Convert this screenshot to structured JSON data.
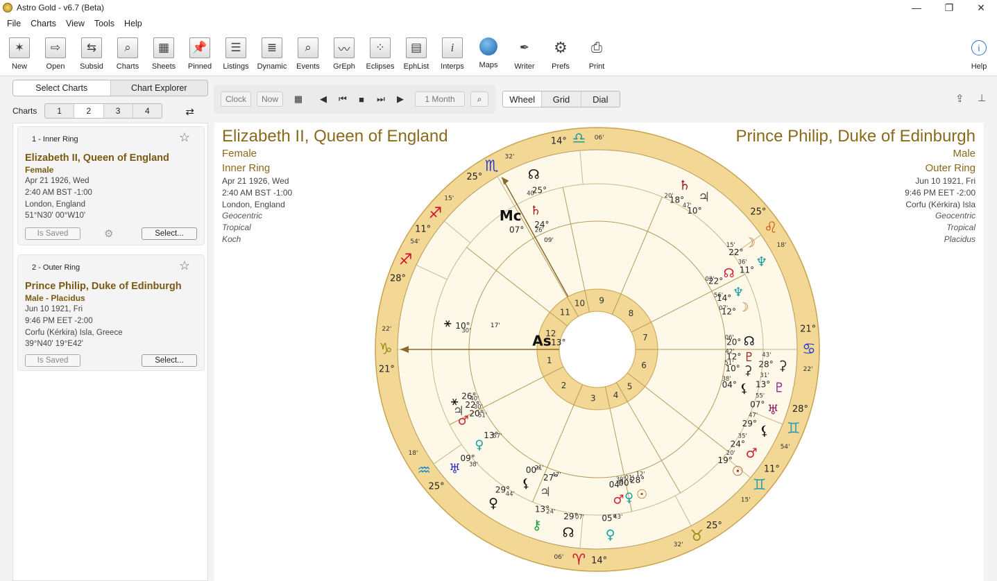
{
  "window": {
    "title": "Astro Gold - v6.7 (Beta)",
    "minimize": "—",
    "maximize": "❐",
    "close": "✕"
  },
  "menu": [
    "File",
    "Charts",
    "View",
    "Tools",
    "Help"
  ],
  "toolbar": [
    "New",
    "Open",
    "Subsid",
    "Charts",
    "Sheets",
    "Pinned",
    "Listings",
    "Dynamic",
    "Events",
    "GrEph",
    "Eclipses",
    "EphList",
    "Interps",
    "Maps",
    "Writer",
    "Prefs",
    "Print"
  ],
  "toolbar_help": "Help",
  "sidebar": {
    "tabs": [
      "Select Charts",
      "Chart Explorer"
    ],
    "charts_label": "Charts",
    "chart_slots": [
      "1",
      "2",
      "3",
      "4"
    ],
    "cards": [
      {
        "ring": "1 - Inner Ring",
        "name": "Elizabeth II, Queen of England",
        "sub": "Female",
        "date": "Apr 21 1926, Wed",
        "time": "2:40 AM BST -1:00",
        "place": "London, England",
        "coords": "51°N30' 00°W10'",
        "saved": "Is Saved",
        "select": "Select..."
      },
      {
        "ring": "2 - Outer Ring",
        "name": "Prince Philip, Duke of Edinburgh",
        "sub": "Male - Placidus",
        "date": "Jun 10 1921, Fri",
        "time": "9:46 PM EET -2:00",
        "place": "Corfu (Kérkira) Isla, Greece",
        "coords": "39°N40' 19°E42'",
        "saved": "Is Saved",
        "select": "Select..."
      }
    ]
  },
  "nav": {
    "clock": "Clock",
    "now": "Now",
    "step": "1 Month"
  },
  "views": [
    "Wheel",
    "Grid",
    "Dial"
  ],
  "left_info": {
    "name": "Elizabeth II, Queen of England",
    "gender": "Female",
    "ring": "Inner Ring",
    "date": "Apr 21 1926, Wed",
    "time": "2:40 AM BST -1:00",
    "place": "London, England",
    "c1": "Geocentric",
    "c2": "Tropical",
    "c3": "Koch"
  },
  "right_info": {
    "name": "Prince Philip, Duke of Edinburgh",
    "gender": "Male",
    "ring": "Outer Ring",
    "date": "Jun 10 1921, Fri",
    "time": "9:46 PM EET -2:00",
    "place": "Corfu (Kérkira) Isla",
    "c1": "Geocentric",
    "c2": "Tropical",
    "c3": "Placidus"
  },
  "wheel": {
    "outer_cusps": [
      {
        "deg": "14°",
        "sign": "♎",
        "min": "06'"
      },
      {
        "deg": "25°",
        "sign": "♌",
        "min": "18'"
      },
      {
        "deg": "21°",
        "sign": "♋",
        "min": "22'"
      },
      {
        "deg": "28°",
        "sign": "♊",
        "min": "54'"
      },
      {
        "deg": "11°",
        "sign": "♊",
        "min": "15'"
      },
      {
        "deg": "25°",
        "sign": "♉",
        "min": "32'"
      },
      {
        "deg": "14°",
        "sign": "♈",
        "min": "06'"
      },
      {
        "deg": "25°",
        "sign": "♒",
        "min": "18'"
      },
      {
        "deg": "21°",
        "sign": "♑",
        "min": "22'"
      },
      {
        "deg": "28°",
        "sign": "♐",
        "min": "54'"
      },
      {
        "deg": "11°",
        "sign": "♐",
        "min": "15'"
      },
      {
        "deg": "25°",
        "sign": "♏",
        "min": "32'"
      }
    ],
    "house_numbers": [
      "1",
      "2",
      "3",
      "4",
      "5",
      "6",
      "7",
      "8",
      "9",
      "10",
      "11",
      "12"
    ],
    "angles": {
      "mc": "Mc",
      "asc": "As",
      "mc_deg": "07°",
      "mc_min": "09'",
      "asc_deg": "13°",
      "asc_min": "17'"
    },
    "outer_planets": [
      {
        "glyph": "♄",
        "deg": "18°",
        "min": "20'"
      },
      {
        "glyph": "♃",
        "deg": "10°",
        "min": "47'"
      },
      {
        "glyph": "☽",
        "deg": "22°",
        "min": "15'"
      },
      {
        "glyph": "♆",
        "deg": "11°",
        "min": "36'"
      },
      {
        "glyph": "⚳",
        "deg": "28°",
        "min": "43'"
      },
      {
        "glyph": "♇",
        "deg": "13°",
        "min": "31'"
      },
      {
        "glyph": "♅",
        "deg": "07°",
        "min": "55'"
      },
      {
        "glyph": "⚸",
        "deg": "29°",
        "min": "47'"
      },
      {
        "glyph": "♂",
        "deg": "24°",
        "min": "35'"
      },
      {
        "glyph": "☉",
        "deg": "19°",
        "min": "20'"
      },
      {
        "glyph": "♀",
        "deg": "05°",
        "min": "43'"
      },
      {
        "glyph": "☊",
        "deg": "29°",
        "min": "07'"
      },
      {
        "glyph": "⚷",
        "deg": "13°",
        "min": "24'"
      },
      {
        "glyph": "♀",
        "deg": "29°",
        "min": "44'"
      },
      {
        "glyph": "♅",
        "deg": "09°",
        "min": "38'"
      },
      {
        "glyph": "☊",
        "deg": "25°",
        "min": "40'"
      }
    ],
    "inner_planets": [
      {
        "glyph": "♄",
        "deg": "24°",
        "min": "26'"
      },
      {
        "glyph": "☊",
        "deg": "22°",
        "min": "02'"
      },
      {
        "glyph": "♆",
        "deg": "14°",
        "min": "56'"
      },
      {
        "glyph": "☽",
        "deg": "12°",
        "min": "07'"
      },
      {
        "glyph": "☊",
        "deg": "20°",
        "min": "06'"
      },
      {
        "glyph": "♇",
        "deg": "12°",
        "min": "42'"
      },
      {
        "glyph": "⚳",
        "deg": "10°",
        "min": "51'"
      },
      {
        "glyph": "⚸",
        "deg": "04°",
        "min": "38'"
      },
      {
        "glyph": "☉",
        "deg": "28°",
        "min": "12'"
      },
      {
        "glyph": "♀",
        "deg": "00°",
        "min": "01'"
      },
      {
        "glyph": "♂",
        "deg": "04°",
        "min": "39'"
      },
      {
        "glyph": "♃",
        "deg": "27°",
        "min": "47'"
      },
      {
        "glyph": "⚸",
        "deg": "00°",
        "min": "21'"
      },
      {
        "glyph": "♀",
        "deg": "13°",
        "min": "57'"
      },
      {
        "glyph": "♂",
        "deg": "20°",
        "min": "51'"
      },
      {
        "glyph": "♃",
        "deg": "22°",
        "min": "30'"
      },
      {
        "glyph": "⚹",
        "deg": "26°",
        "min": "40'"
      },
      {
        "glyph": "⚹",
        "deg": "10°",
        "min": "30'"
      }
    ]
  }
}
